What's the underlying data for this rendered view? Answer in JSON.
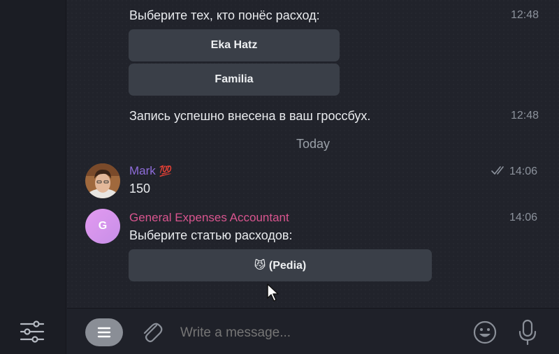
{
  "messages": {
    "bot_prompt_1": {
      "text": "Выберите тех, кто понёс расход:",
      "time": "12:48"
    },
    "keyboard_1": [
      "Eka Hatz",
      "Familia"
    ],
    "bot_confirm": {
      "text": "Запись успешно внесена в ваш гроссбух.",
      "time": "12:48"
    },
    "date_separator": "Today",
    "user_msg": {
      "sender": "Mark",
      "badge": "💯",
      "text": "150",
      "time": "14:06"
    },
    "bot_msg": {
      "sender": "General Expenses Accountant",
      "avatar_letter": "G",
      "text": "Выберите статью расходов:",
      "time": "14:06"
    },
    "keyboard_2": [
      "😼 (Pedia)"
    ]
  },
  "composer": {
    "placeholder": "Write a message..."
  },
  "colors": {
    "accent_mark": "#8e6cd9",
    "accent_bot": "#d9558f",
    "button_bg": "#3a3f48"
  }
}
